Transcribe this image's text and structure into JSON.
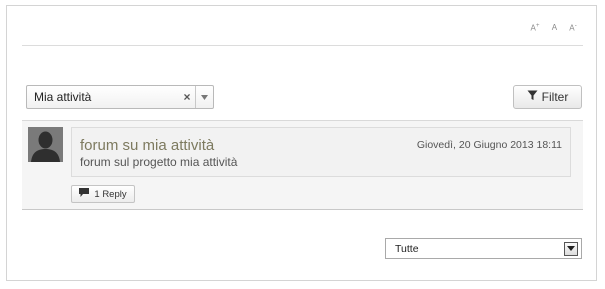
{
  "font_size_controls": {
    "increase": "A",
    "increase_sup": "+",
    "normal": "A",
    "decrease": "A",
    "decrease_sup": "-"
  },
  "activity_select": {
    "value": "Mia attività"
  },
  "filter_button": {
    "label": "Filter"
  },
  "post": {
    "title": "forum su mia attività",
    "date": "Giovedì, 20 Giugno 2013 18:11",
    "body": "forum sul progetto mia attività",
    "reply_label": "1 Reply"
  },
  "bottom_select": {
    "value": "Tutte"
  },
  "icons": {
    "clear": "close-icon",
    "dropdown": "chevron-down-icon",
    "filter": "funnel-icon",
    "reply": "comment-icon",
    "avatar": "user-silhouette-icon"
  },
  "colors": {
    "title": "#7d7a5f",
    "avatar_bg": "#7a7a7a"
  }
}
